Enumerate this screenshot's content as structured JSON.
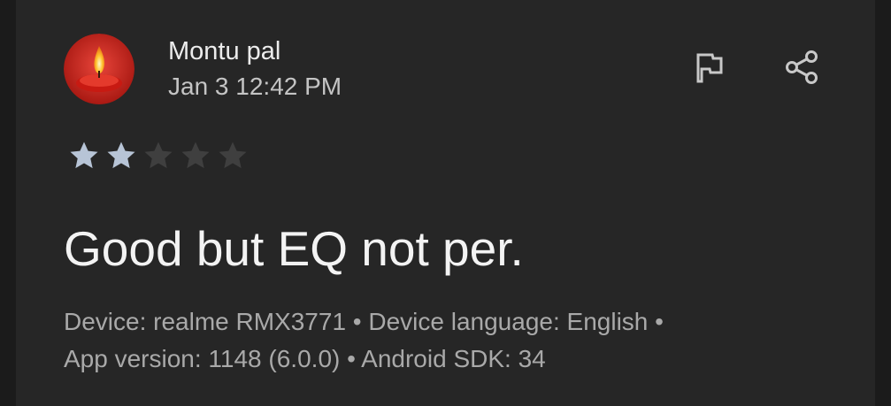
{
  "review": {
    "author": "Montu pal",
    "date": "Jan 3 12:42 PM",
    "rating": 2,
    "max_rating": 5,
    "title": "Good but EQ not per.",
    "meta_line1": "Device: realme RMX3771 • Device language: English •",
    "meta_line2": "App version: 1148 (6.0.0) • Android SDK: 34"
  },
  "icons": {
    "avatar": "candle-avatar-icon",
    "flag": "flag-icon",
    "share": "share-icon",
    "star": "star-icon"
  },
  "colors": {
    "background": "#262626",
    "star_filled": "#b7c4d6",
    "star_empty": "#3f3f3f",
    "text_primary": "#f3f3f3",
    "text_secondary": "#a9a9a9"
  }
}
